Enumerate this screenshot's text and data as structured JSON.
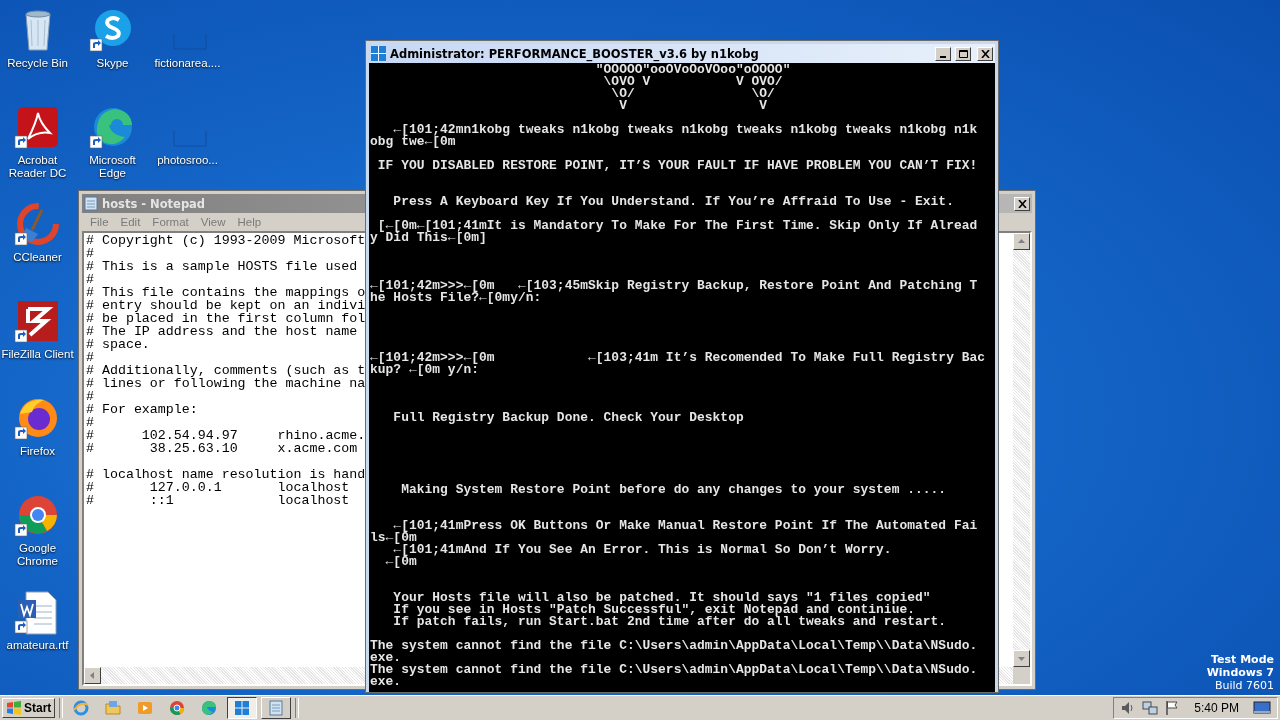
{
  "desktop": {
    "icon_columns": [
      [
        {
          "label": "Recycle Bin",
          "kind": "bin"
        },
        {
          "label": "Acrobat Reader DC",
          "kind": "acrobat"
        },
        {
          "label": "CCleaner",
          "kind": "ccleaner"
        },
        {
          "label": "FileZilla Client",
          "kind": "filezilla"
        },
        {
          "label": "Firefox",
          "kind": "firefox"
        },
        {
          "label": "Google Chrome",
          "kind": "chrome"
        },
        {
          "label": "amateura.rtf",
          "kind": "word"
        }
      ],
      [
        {
          "label": "Skype",
          "kind": "skype"
        },
        {
          "label": "Microsoft Edge",
          "kind": "edge"
        }
      ],
      [
        {
          "label": "fictionarea....",
          "kind": "blank"
        },
        {
          "label": "photosroo...",
          "kind": "blank"
        }
      ]
    ],
    "edition": [
      "Test Mode",
      "Windows 7",
      "Build 7601"
    ]
  },
  "notepad": {
    "title": "hosts - Notepad",
    "active": false,
    "menu": [
      "File",
      "Edit",
      "Format",
      "View",
      "Help"
    ],
    "text": "# Copyright (c) 1993-2009 Microsoft\n#\n# This is a sample HOSTS file used\n#\n# This file contains the mappings o\n# entry should be kept on an indivi\n# be placed in the first column fol\n# The IP address and the host name\n# space.\n#\n# Additionally, comments (such as t\n# lines or following the machine na\n#\n# For example:\n#\n#      102.54.94.97     rhino.acme.\n#       38.25.63.10     x.acme.com\n\n# localhost name resolution is hand\n#       127.0.0.1       localhost\n#       ::1             localhost"
  },
  "console": {
    "title": "Administrator: PERFORMANCE_BOOSTER_v3.6 by n1kobg",
    "active": true,
    "output": "                             \"OOOOO\"ooOVoOoVOoo\"oOOOO\"\n                              \\OVO V           V OVO/\n                               \\O/               \\O/\n                                V                 V\n\n   ←[101;42mn1kobg tweaks n1kobg tweaks n1kobg tweaks n1kobg tweaks n1kobg n1k\nobg twe←[0m\n\n IF YOU DISABLED RESTORE POINT, IT’S YOUR FAULT IF HAVE PROBLEM YOU CAN’T FIX!\n\n\n   Press A Keyboard Key If You Understand. If You’re Affraid To Use - Exit.\n\n [←[0m←[101;41mIt is Mandatory To Make For The First Time. Skip Only If Alread\ny Did This←[0m]\n\n\n\n←[101;42m>>>←[0m   ←[103;45mSkip Registry Backup, Restore Point And Patching T\nhe Hosts File?←[0my/n:\n\n\n\n\n←[101;42m>>>←[0m            ←[103;41m It’s Recomended To Make Full Registry Bac\nkup? ←[0m y/n:\n\n\n\n   Full Registry Backup Done. Check Your Desktop\n\n\n\n\n\n    Making System Restore Point before do any changes to your system .....\n\n\n   ←[101;41mPress OK Buttons Or Make Manual Restore Point If The Automated Fai\nls←[0m\n   ←[101;41mAnd If You See An Error. This is Normal So Don’t Worry.\n  ←[0m\n\n\n   Your Hosts file will also be patched. It should says \"1 files copied\"\n   If you see in Hosts \"Patch Successful\", exit Notepad and continiue.\n   If patch fails, run Start.bat 2nd time after do all tweaks and restart.\n\nThe system cannot find the file C:\\Users\\admin\\AppData\\Local\\Temp\\\\Data\\NSudo.\nexe.\nThe system cannot find the file C:\\Users\\admin\\AppData\\Local\\Temp\\\\Data\\NSudo.\nexe."
  },
  "taskbar": {
    "start": "Start",
    "items": [
      {
        "kind": "ie",
        "selected": false
      },
      {
        "kind": "folder",
        "selected": false
      },
      {
        "kind": "media",
        "selected": false
      },
      {
        "kind": "chrome",
        "selected": false
      },
      {
        "kind": "edge",
        "selected": false
      },
      {
        "kind": "console",
        "selected": true
      },
      {
        "kind": "notepad",
        "selected": false
      }
    ],
    "clock": "5:40 PM"
  }
}
